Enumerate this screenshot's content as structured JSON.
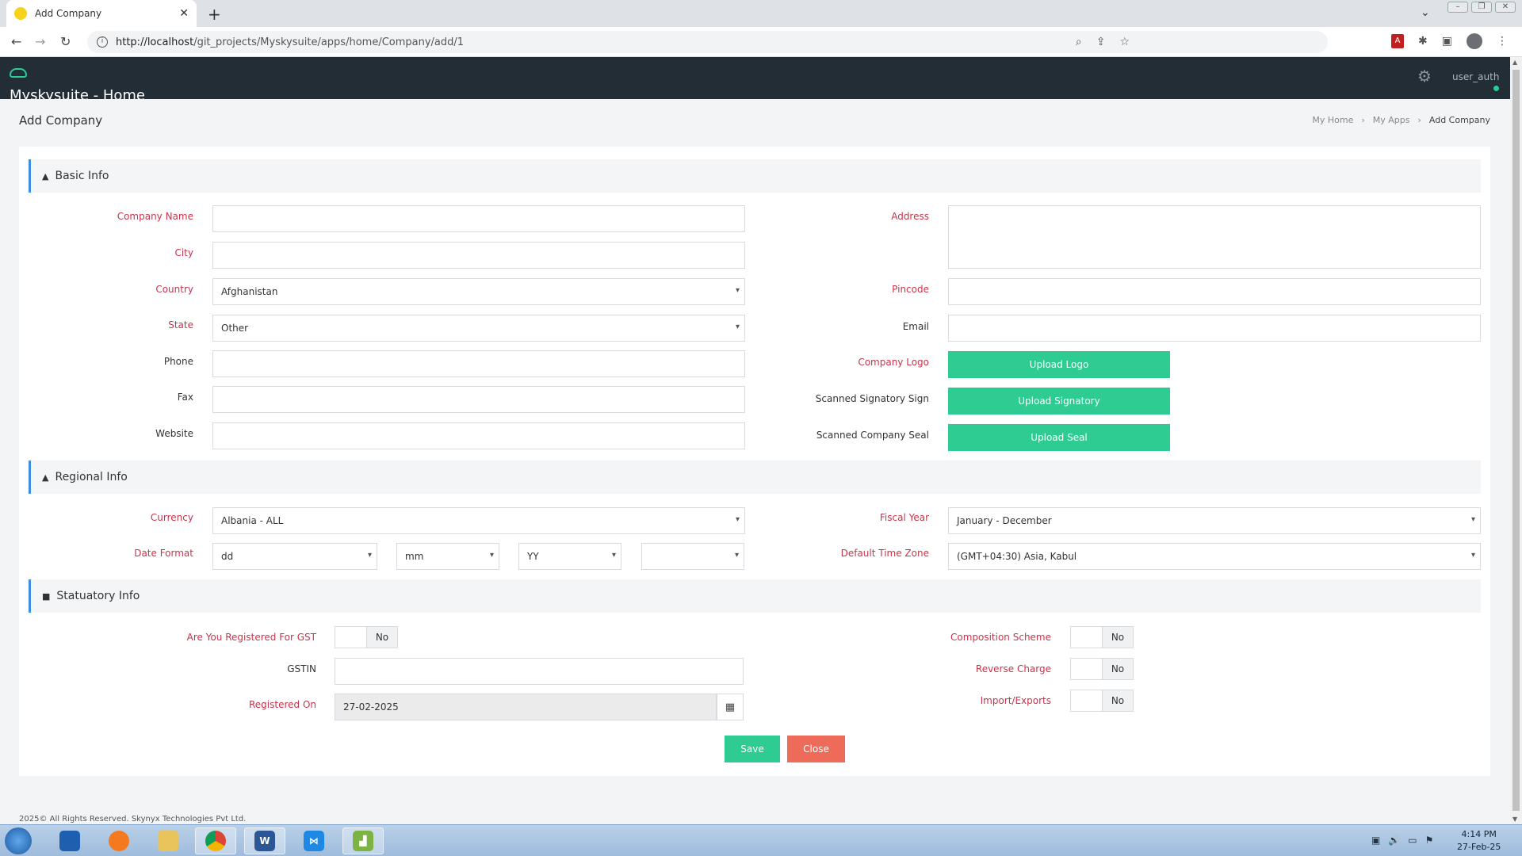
{
  "browser": {
    "tab_title": "Add Company",
    "tab_close": "✕",
    "new_tab": "+",
    "url_host": "http://localhost",
    "url_path": "/git_projects/Myskysuite/apps/home/Company/add/1"
  },
  "app": {
    "name": "Myskysuite - Home",
    "user": "user_auth"
  },
  "page": {
    "title": "Add Company",
    "breadcrumbs": [
      "My Home",
      "My Apps",
      "Add Company"
    ]
  },
  "sections": {
    "basic": "Basic Info",
    "regional": "Regional Info",
    "statutory": "Statuatory Info"
  },
  "basic": {
    "company_name_label": "Company Name",
    "city_label": "City",
    "country_label": "Country",
    "country_value": "Afghanistan",
    "state_label": "State",
    "state_value": "Other",
    "phone_label": "Phone",
    "fax_label": "Fax",
    "website_label": "Website",
    "address_label": "Address",
    "pincode_label": "Pincode",
    "email_label": "Email",
    "logo_label": "Company Logo",
    "logo_button": "Upload Logo",
    "sign_label": "Scanned Signatory Sign",
    "sign_button": "Upload Signatory",
    "seal_label": "Scanned Company Seal",
    "seal_button": "Upload Seal"
  },
  "regional": {
    "currency_label": "Currency",
    "currency_value": "Albania - ALL",
    "date_format_label": "Date Format",
    "date_dd": "dd",
    "date_mm": "mm",
    "date_yy": "YY",
    "date_sep": "",
    "fiscal_label": "Fiscal Year",
    "fiscal_value": "January - December",
    "tz_label": "Default Time Zone",
    "tz_value": "(GMT+04:30) Asia, Kabul"
  },
  "statutory": {
    "gst_label": "Are You Registered For GST",
    "gst_value": "No",
    "gstin_label": "GSTIN",
    "registered_label": "Registered On",
    "registered_value": "27-02-2025",
    "composition_label": "Composition Scheme",
    "composition_value": "No",
    "reverse_label": "Reverse Charge",
    "reverse_value": "No",
    "import_label": "Import/Exports",
    "import_value": "No"
  },
  "actions": {
    "save": "Save",
    "close": "Close"
  },
  "footer": "2025© All Rights Reserved. Skynyx Technologies Pvt Ltd.",
  "taskbar": {
    "time": "4:14 PM",
    "date": "27-Feb-25"
  },
  "colors": {
    "accent_green": "#2ecc92",
    "close_red": "#ee6b5a",
    "required_red": "#c9334a",
    "header_dark": "#222d36"
  }
}
